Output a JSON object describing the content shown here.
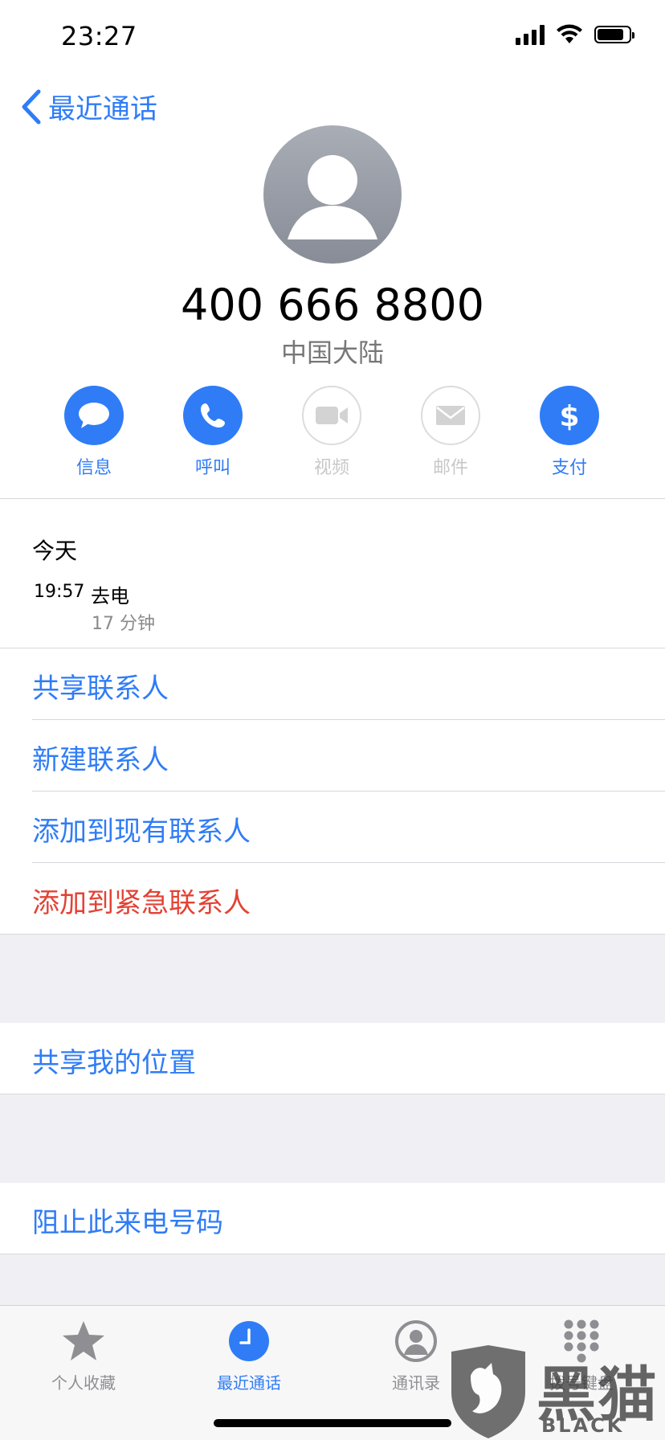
{
  "status_bar": {
    "time": "23:27"
  },
  "nav": {
    "back_label": "最近通话"
  },
  "contact": {
    "number": "400 666 8800",
    "region": "中国大陆"
  },
  "actions": [
    {
      "label": "信息",
      "icon": "message-bubble-icon",
      "enabled": true
    },
    {
      "label": "呼叫",
      "icon": "phone-icon",
      "enabled": true
    },
    {
      "label": "视频",
      "icon": "video-camera-icon",
      "enabled": false
    },
    {
      "label": "邮件",
      "icon": "mail-icon",
      "enabled": false
    },
    {
      "label": "支付",
      "icon": "dollar-icon",
      "enabled": true
    }
  ],
  "call_history": {
    "title": "今天",
    "entries": [
      {
        "time": "19:57",
        "type": "去电",
        "duration": "17 分钟"
      }
    ]
  },
  "contact_options": [
    {
      "label": "共享联系人"
    },
    {
      "label": "新建联系人"
    },
    {
      "label": "添加到现有联系人"
    },
    {
      "label": "添加到紧急联系人"
    }
  ],
  "location_option": {
    "label": "共享我的位置"
  },
  "block_option": {
    "label": "阻止此来电号码"
  },
  "tab_bar": {
    "tabs": [
      {
        "label": "个人收藏",
        "icon": "star-icon",
        "active": false
      },
      {
        "label": "最近通话",
        "icon": "clock-icon",
        "active": true
      },
      {
        "label": "通讯录",
        "icon": "person-circle-icon",
        "active": false
      },
      {
        "label": "拨号键盘",
        "icon": "keypad-icon",
        "active": false
      }
    ]
  },
  "watermark": {
    "text_cn": "黑猫",
    "text_en": "BLACK CAT"
  },
  "colors": {
    "accent": "#2f7cf6",
    "destructive": "#e34234",
    "group_background": "#efeff4"
  }
}
